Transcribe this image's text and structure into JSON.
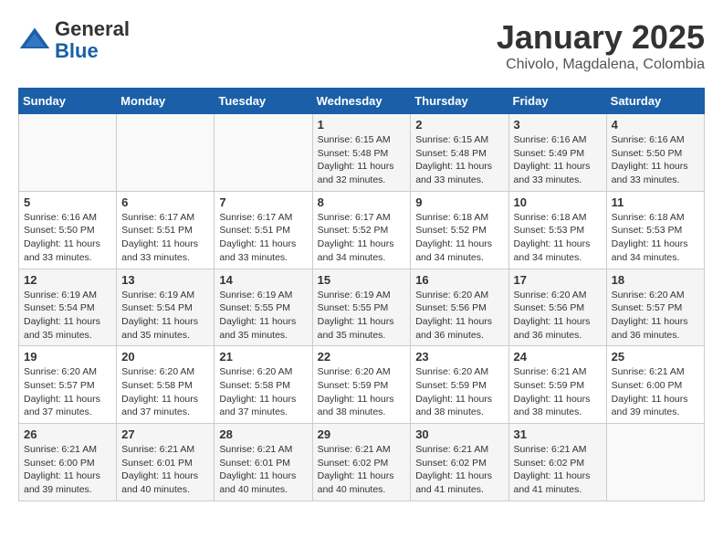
{
  "header": {
    "logo_line1": "General",
    "logo_line2": "Blue",
    "month": "January 2025",
    "location": "Chivolo, Magdalena, Colombia"
  },
  "weekdays": [
    "Sunday",
    "Monday",
    "Tuesday",
    "Wednesday",
    "Thursday",
    "Friday",
    "Saturday"
  ],
  "weeks": [
    [
      {
        "day": "",
        "info": ""
      },
      {
        "day": "",
        "info": ""
      },
      {
        "day": "",
        "info": ""
      },
      {
        "day": "1",
        "info": "Sunrise: 6:15 AM\nSunset: 5:48 PM\nDaylight: 11 hours\nand 32 minutes."
      },
      {
        "day": "2",
        "info": "Sunrise: 6:15 AM\nSunset: 5:48 PM\nDaylight: 11 hours\nand 33 minutes."
      },
      {
        "day": "3",
        "info": "Sunrise: 6:16 AM\nSunset: 5:49 PM\nDaylight: 11 hours\nand 33 minutes."
      },
      {
        "day": "4",
        "info": "Sunrise: 6:16 AM\nSunset: 5:50 PM\nDaylight: 11 hours\nand 33 minutes."
      }
    ],
    [
      {
        "day": "5",
        "info": "Sunrise: 6:16 AM\nSunset: 5:50 PM\nDaylight: 11 hours\nand 33 minutes."
      },
      {
        "day": "6",
        "info": "Sunrise: 6:17 AM\nSunset: 5:51 PM\nDaylight: 11 hours\nand 33 minutes."
      },
      {
        "day": "7",
        "info": "Sunrise: 6:17 AM\nSunset: 5:51 PM\nDaylight: 11 hours\nand 33 minutes."
      },
      {
        "day": "8",
        "info": "Sunrise: 6:17 AM\nSunset: 5:52 PM\nDaylight: 11 hours\nand 34 minutes."
      },
      {
        "day": "9",
        "info": "Sunrise: 6:18 AM\nSunset: 5:52 PM\nDaylight: 11 hours\nand 34 minutes."
      },
      {
        "day": "10",
        "info": "Sunrise: 6:18 AM\nSunset: 5:53 PM\nDaylight: 11 hours\nand 34 minutes."
      },
      {
        "day": "11",
        "info": "Sunrise: 6:18 AM\nSunset: 5:53 PM\nDaylight: 11 hours\nand 34 minutes."
      }
    ],
    [
      {
        "day": "12",
        "info": "Sunrise: 6:19 AM\nSunset: 5:54 PM\nDaylight: 11 hours\nand 35 minutes."
      },
      {
        "day": "13",
        "info": "Sunrise: 6:19 AM\nSunset: 5:54 PM\nDaylight: 11 hours\nand 35 minutes."
      },
      {
        "day": "14",
        "info": "Sunrise: 6:19 AM\nSunset: 5:55 PM\nDaylight: 11 hours\nand 35 minutes."
      },
      {
        "day": "15",
        "info": "Sunrise: 6:19 AM\nSunset: 5:55 PM\nDaylight: 11 hours\nand 35 minutes."
      },
      {
        "day": "16",
        "info": "Sunrise: 6:20 AM\nSunset: 5:56 PM\nDaylight: 11 hours\nand 36 minutes."
      },
      {
        "day": "17",
        "info": "Sunrise: 6:20 AM\nSunset: 5:56 PM\nDaylight: 11 hours\nand 36 minutes."
      },
      {
        "day": "18",
        "info": "Sunrise: 6:20 AM\nSunset: 5:57 PM\nDaylight: 11 hours\nand 36 minutes."
      }
    ],
    [
      {
        "day": "19",
        "info": "Sunrise: 6:20 AM\nSunset: 5:57 PM\nDaylight: 11 hours\nand 37 minutes."
      },
      {
        "day": "20",
        "info": "Sunrise: 6:20 AM\nSunset: 5:58 PM\nDaylight: 11 hours\nand 37 minutes."
      },
      {
        "day": "21",
        "info": "Sunrise: 6:20 AM\nSunset: 5:58 PM\nDaylight: 11 hours\nand 37 minutes."
      },
      {
        "day": "22",
        "info": "Sunrise: 6:20 AM\nSunset: 5:59 PM\nDaylight: 11 hours\nand 38 minutes."
      },
      {
        "day": "23",
        "info": "Sunrise: 6:20 AM\nSunset: 5:59 PM\nDaylight: 11 hours\nand 38 minutes."
      },
      {
        "day": "24",
        "info": "Sunrise: 6:21 AM\nSunset: 5:59 PM\nDaylight: 11 hours\nand 38 minutes."
      },
      {
        "day": "25",
        "info": "Sunrise: 6:21 AM\nSunset: 6:00 PM\nDaylight: 11 hours\nand 39 minutes."
      }
    ],
    [
      {
        "day": "26",
        "info": "Sunrise: 6:21 AM\nSunset: 6:00 PM\nDaylight: 11 hours\nand 39 minutes."
      },
      {
        "day": "27",
        "info": "Sunrise: 6:21 AM\nSunset: 6:01 PM\nDaylight: 11 hours\nand 40 minutes."
      },
      {
        "day": "28",
        "info": "Sunrise: 6:21 AM\nSunset: 6:01 PM\nDaylight: 11 hours\nand 40 minutes."
      },
      {
        "day": "29",
        "info": "Sunrise: 6:21 AM\nSunset: 6:02 PM\nDaylight: 11 hours\nand 40 minutes."
      },
      {
        "day": "30",
        "info": "Sunrise: 6:21 AM\nSunset: 6:02 PM\nDaylight: 11 hours\nand 41 minutes."
      },
      {
        "day": "31",
        "info": "Sunrise: 6:21 AM\nSunset: 6:02 PM\nDaylight: 11 hours\nand 41 minutes."
      },
      {
        "day": "",
        "info": ""
      }
    ]
  ]
}
